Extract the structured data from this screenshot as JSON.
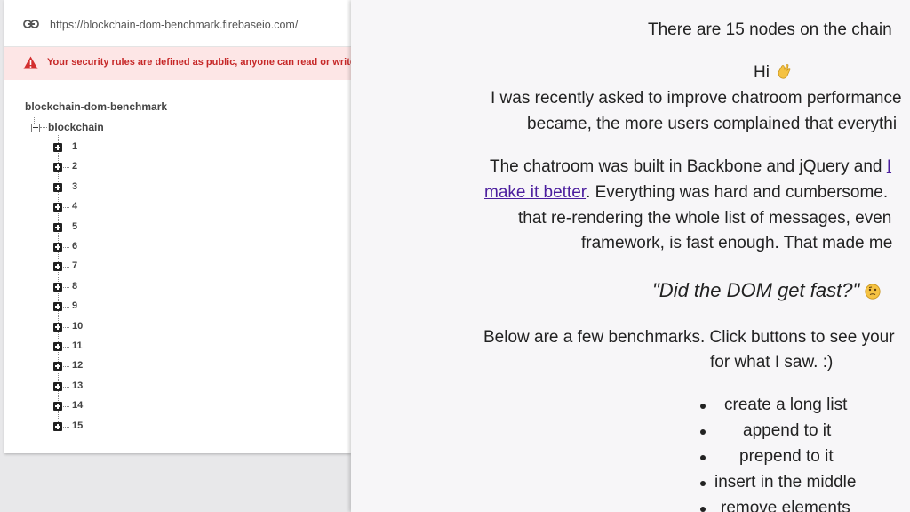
{
  "firebase": {
    "url": "https://blockchain-dom-benchmark.firebaseio.com/",
    "warning": "Your security rules are defined as public, anyone can read or write to",
    "tree_root": "blockchain-dom-benchmark",
    "tree_node": "blockchain",
    "children": [
      "1",
      "2",
      "3",
      "4",
      "5",
      "6",
      "7",
      "8",
      "9",
      "10",
      "11",
      "12",
      "13",
      "14",
      "15"
    ]
  },
  "article": {
    "nodes_line": "There are 15 nodes on the chain",
    "greeting": "Hi",
    "p1_line1": "I was recently asked to improve chatroom performance",
    "p1_line2": "became, the more users complained that everythi",
    "p2_line1_pre": "The chatroom was built in Backbone and jQuery and",
    "p2_line1_link": "I",
    "p2_line2_link": "make it better",
    "p2_line2_post": ". Everything was hard and cumbersome.",
    "p2_line3": "that re-rendering the whole list of messages, even",
    "p2_line4": "framework, is fast enough. That made me",
    "question": "\"Did the DOM get fast?\"",
    "p3_line1": "Below are a few benchmarks. Click buttons to see your",
    "p3_line2": "for what I saw. :)",
    "list": [
      "create a long list",
      "append to it",
      "prepend to it",
      "insert in the middle",
      "remove elements"
    ]
  },
  "colors": {
    "warning_bg": "#fde6e6",
    "warning_text": "#c62828",
    "link": "#4b1e9e"
  }
}
